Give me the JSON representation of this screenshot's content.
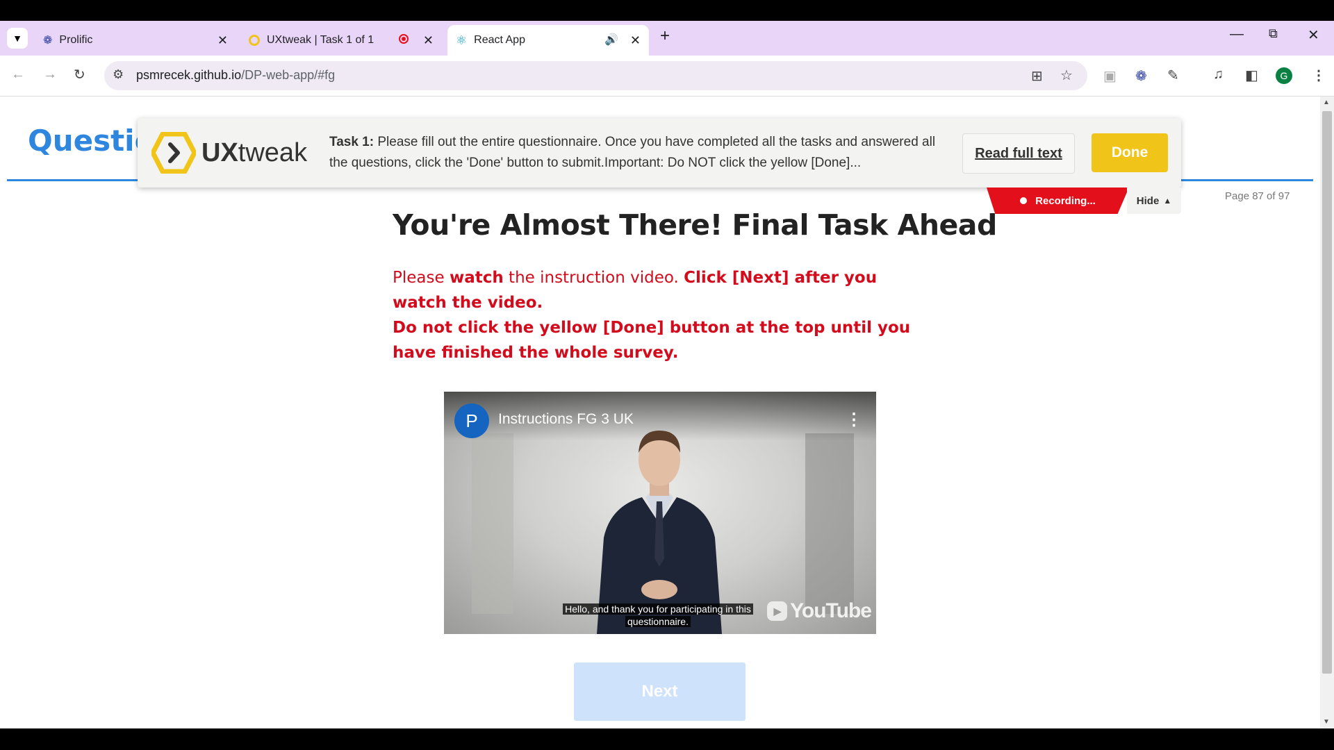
{
  "browser": {
    "tabs": [
      {
        "title": "Prolific"
      },
      {
        "title": "UXtweak | Task 1 of 1"
      },
      {
        "title": "React App"
      }
    ],
    "url_domain": "psmrecek.github.io",
    "url_path": "/DP-web-app/#fg",
    "profile_initial": "G"
  },
  "page": {
    "section_title": "Questio",
    "page_counter": "Page 87 of 97",
    "heading": "You're Almost There! Final Task Ahead",
    "instructions": {
      "p1_a": "Please ",
      "p1_b": "watch",
      "p1_c": " the instruction video. ",
      "p1_d": "Click [Next] after you watch the video.",
      "p2": "Do not click the yellow [Done] button at the top until you have finished the whole survey."
    },
    "next_label": "Next"
  },
  "uxtweak": {
    "logo_text_a": "UX",
    "logo_text_b": "tweak",
    "task_label": "Task 1:",
    "task_text": " Please fill out the entire questionnaire. Once you have completed all the tasks and answered all the questions, click the 'Done' button to submit.Important: Do NOT click the yellow [Done]...",
    "read_full_label": "Read full text",
    "done_label": "Done",
    "recording_label": "Recording...",
    "hide_label": "Hide"
  },
  "video": {
    "channel_initial": "P",
    "title": "Instructions FG 3 UK",
    "caption_line1": "Hello, and thank you for participating in this",
    "caption_line2": "questionnaire.",
    "youtube_label": "YouTube"
  },
  "colors": {
    "tabbar": "#e9d5f7",
    "accent_blue": "#2e86de",
    "instruction_red": "#d20c1c",
    "done_yellow": "#f0c419",
    "recording_red": "#e3101b"
  }
}
